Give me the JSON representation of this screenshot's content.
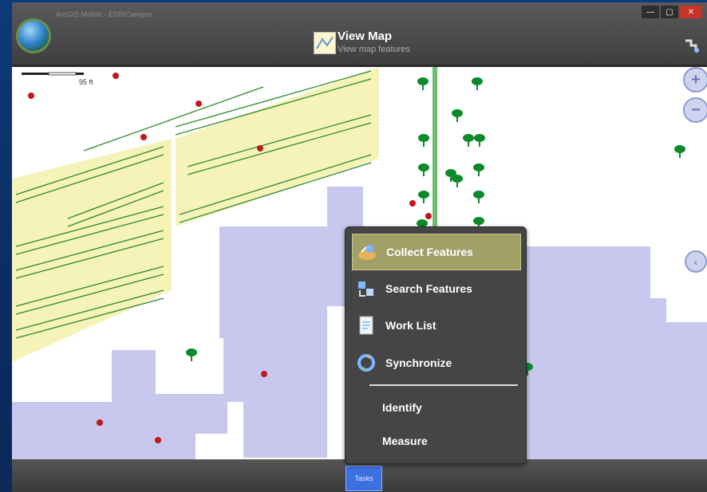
{
  "window": {
    "caption": "ArcGIS Mobile - ESRICampus",
    "buttons": [
      "—",
      "▢",
      "✕"
    ]
  },
  "header": {
    "title": "View Map",
    "subtitle": "View map features"
  },
  "map": {
    "scale_label": "95 ft"
  },
  "menu": {
    "items": [
      {
        "label": "Collect Features",
        "icon": "collect-features-icon",
        "selected": true
      },
      {
        "label": "Search Features",
        "icon": "search-features-icon",
        "selected": false
      },
      {
        "label": "Work List",
        "icon": "document-icon",
        "selected": false
      },
      {
        "label": "Synchronize",
        "icon": "sync-icon",
        "selected": false
      }
    ],
    "plain_items": [
      "Identify",
      "Measure"
    ]
  },
  "bottom": {
    "tasks_label": "Tasks"
  },
  "colors": {
    "parking": "#f6f3b8",
    "parking_lines": "#2b8a2b",
    "building": "#c8c8ee",
    "tree": "#0a8a2a",
    "point": "#c2151c",
    "menu_selected": "#a0a068"
  }
}
